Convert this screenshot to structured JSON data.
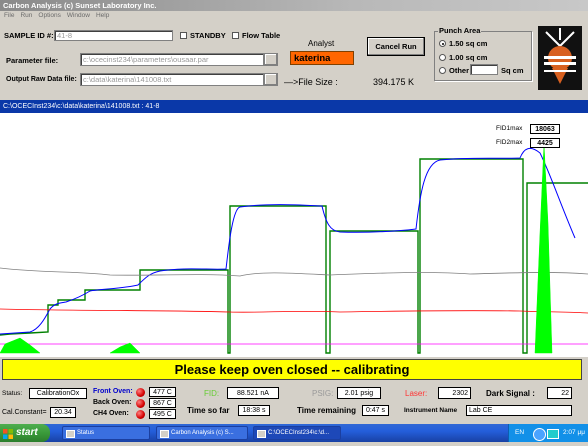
{
  "window": {
    "title": "Carbon Analysis (c) Sunset Laboratory Inc."
  },
  "menu": [
    "File",
    "Run",
    "Options",
    "Window",
    "Help"
  ],
  "sample": {
    "label": "SAMPLE  ID #:",
    "value": "41-8"
  },
  "standby": {
    "label": "STANDBY",
    "checked": false
  },
  "flow_table": {
    "label": "Flow Table",
    "checked": false
  },
  "parameter_file": {
    "label": "Parameter file:",
    "value": "c:\\ocecinst234\\parameters\\ousaar.par"
  },
  "output_file": {
    "label": "Output Raw Data file:",
    "value": "c:\\data\\katerina\\141008.txt"
  },
  "analyst": {
    "label": "Analyst",
    "value": "katerina"
  },
  "cancel_button": "Cancel Run",
  "file_size": {
    "label": "—>File Size :",
    "value": "394.175 K"
  },
  "punch_area": {
    "title": "Punch Area",
    "options": [
      "1.50 sq cm",
      "1.00 sq cm",
      "Other"
    ],
    "selected": 0,
    "other_unit": "Sq cm"
  },
  "plot_header": "C:\\OCECInst234\\c:\\data\\katerina\\141008.txt : 41-8",
  "fid1max": {
    "label": "FID1max",
    "value": "18063"
  },
  "fid2max": {
    "label": "FID2max",
    "value": "4425"
  },
  "status_message": "Please keep oven closed -- calibrating",
  "status": {
    "label": "Status:",
    "value": "CalibrationOx"
  },
  "cal_constant": {
    "label": "Cal.Constant=",
    "value": "20.34"
  },
  "front_oven": {
    "label": "Front Oven:",
    "value": "477 C"
  },
  "back_oven": {
    "label": "Back Oven:",
    "value": "867 C"
  },
  "ch4_oven": {
    "label": "CH4 Oven:",
    "value": "495 C"
  },
  "fid": {
    "label": "FID:",
    "value": "88.521 nA"
  },
  "psig": {
    "label": "PSIG:",
    "value": "2.01 psig"
  },
  "laser": {
    "label": "Laser:",
    "value": "2302"
  },
  "dark_signal": {
    "label": "Dark Signal :",
    "value": "22"
  },
  "time_so_far": {
    "label": "Time so far",
    "value": "18:38 s"
  },
  "time_remaining": {
    "label": "Time remaining",
    "value": "0:47 s"
  },
  "instrument": {
    "label": "Instrument Name",
    "value": "Lab CE"
  },
  "taskbar": {
    "start": "start",
    "tasks": [
      "Status",
      "Carbon Analysis (c) S...",
      "C:\\OCECInst234\\c:\\d..."
    ],
    "lang": "EN",
    "clock": "2:07 μμ"
  },
  "colors": {
    "titlebar": "#8a8a8a",
    "plot_header": "#0a38a8",
    "status_bar": "#ffff00",
    "analyst_bg": "#ff6600",
    "taskbar": "#245edb",
    "start": "#3a9a3a"
  },
  "chart_data": {
    "type": "line",
    "title": "",
    "xlabel": "",
    "ylabel": "",
    "grid": false,
    "series": [
      {
        "color": "#008000",
        "description": "step (temperature program)"
      },
      {
        "color": "#0000ff",
        "description": "FID signal"
      },
      {
        "color": "#808080",
        "description": "trace"
      },
      {
        "color": "#ff0000",
        "description": "trace"
      },
      {
        "color": "#ff00ff",
        "description": "trace"
      },
      {
        "color": "#00ff00",
        "description": "filled trace"
      }
    ]
  }
}
